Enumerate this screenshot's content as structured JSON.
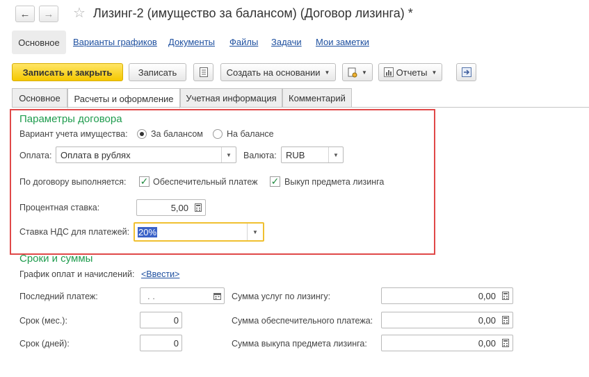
{
  "window": {
    "title": "Лизинг-2 (имущество за балансом) (Договор лизинга) *"
  },
  "nav": {
    "back_icon": "arrow-left-icon",
    "forward_icon": "arrow-right-icon",
    "favorite_icon": "star-icon"
  },
  "sections": {
    "active": "Основное",
    "links": [
      "Варианты графиков",
      "Документы",
      "Файлы",
      "Задачи",
      "Мои заметки"
    ]
  },
  "toolbar": {
    "save_close": "Записать и закрыть",
    "save": "Записать",
    "create_based": "Создать на основании",
    "reports": "Отчеты"
  },
  "tabs": [
    "Основное",
    "Расчеты и оформление",
    "Учетная информация",
    "Комментарий"
  ],
  "contract": {
    "group_title": "Параметры договора",
    "accounting_label": "Вариант учета имущества:",
    "option_off_balance": "За балансом",
    "option_on_balance": "На балансе",
    "selected_option": "За балансом",
    "payment_label": "Оплата:",
    "payment_value": "Оплата в рублях",
    "currency_label": "Валюта:",
    "currency_value": "RUB",
    "performed_label": "По договору выполняется:",
    "security_payment": "Обеспечительный  платеж",
    "buyout": "Выкуп предмета лизинга",
    "rate_label": "Процентная ставка:",
    "rate_value": "5,00",
    "vat_label": "Ставка НДС для платежей:",
    "vat_value": "20%"
  },
  "terms": {
    "group_title": "Сроки и суммы",
    "schedule_label": "График оплат и начислений:",
    "schedule_link": "<Ввести>",
    "last_payment_label": "Последний платеж:",
    "last_payment_value": " .  .",
    "term_months_label": "Срок (мес.):",
    "term_months_value": "0",
    "term_days_label": "Срок (дней):",
    "term_days_value": "0",
    "services_sum_label": "Сумма услуг по лизингу:",
    "services_sum_value": "0,00",
    "security_sum_label": "Сумма обеспечительного платежа:",
    "security_sum_value": "0,00",
    "buyout_sum_label": "Сумма выкупа предмета лизинга:",
    "buyout_sum_value": "0,00"
  },
  "colors": {
    "accent_yellow": "#f5c800",
    "group_green": "#1f9c4e",
    "link_blue": "#1d4f9f",
    "highlight_red": "#e04848"
  }
}
